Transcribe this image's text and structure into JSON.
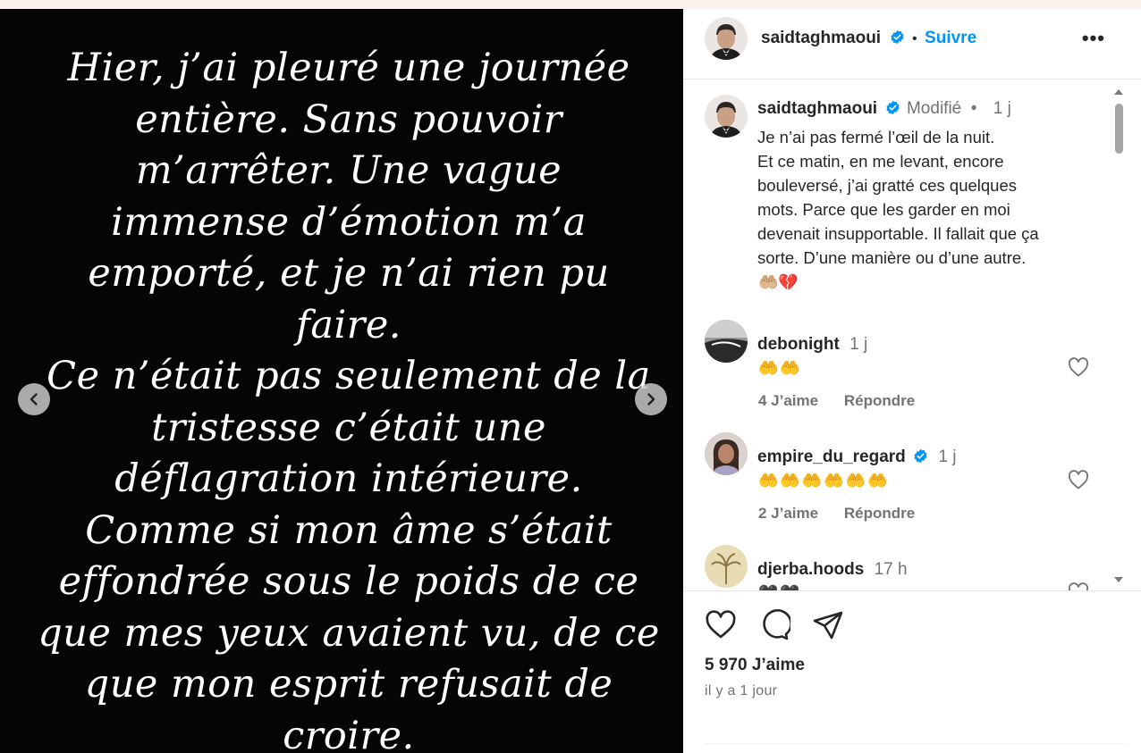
{
  "post_image": {
    "text": "Hier, j’ai pleuré une journée\nentière. Sans pouvoir\nm’arrêter. Une vague\nimmense d’émotion m’a\nemporté, et je n’ai rien pu\nfaire.\nCe n’était pas seulement de la\ntristesse c’était une\ndéflagration intérieure.\nComme si mon âme s’était\neffondrée sous le poids de ce\nque mes yeux avaient vu, de ce\nque mon esprit refusait de\ncroire.",
    "prev_icon": "chevron-left-icon",
    "next_icon": "chevron-right-icon"
  },
  "header": {
    "username": "saidtaghmaoui",
    "separator": "•",
    "follow_label": "Suivre",
    "more_label": "•••"
  },
  "caption": {
    "username": "saidtaghmaoui",
    "edited": "Modifié",
    "separator": "•",
    "time": "1 j",
    "text": "Je n’ai pas fermé l’œil de la nuit.\nEt ce matin, en me levant, encore\nbouleversé, j’ai gratté ces quelques\nmots. Parce que les garder en moi\ndevenait insupportable. Il fallait que ça\nsorte. D’une manière ou d’une autre.",
    "emojis": "🤲🏼💔"
  },
  "comments": [
    {
      "username": "debonight",
      "time": "1 j",
      "text": "🤲🤲",
      "likes": "4 J’aime",
      "reply": "Répondre",
      "verified": false
    },
    {
      "username": "empire_du_regard",
      "time": "1 j",
      "text": "🤲🤲🤲🤲🤲🤲",
      "likes": "2 J’aime",
      "reply": "Répondre",
      "verified": true
    },
    {
      "username": "djerba.hoods",
      "time": "17 h",
      "text": "🖤🖤",
      "verified": false
    }
  ],
  "footer": {
    "likes": "5 970 J’aime",
    "timestamp": "il y a 1 jour",
    "icons": [
      "heart-icon",
      "comment-icon",
      "share-icon"
    ]
  },
  "colors": {
    "link": "#0095f6",
    "verified": "#0095f6",
    "muted": "#737373",
    "media_bg": "#060505"
  }
}
